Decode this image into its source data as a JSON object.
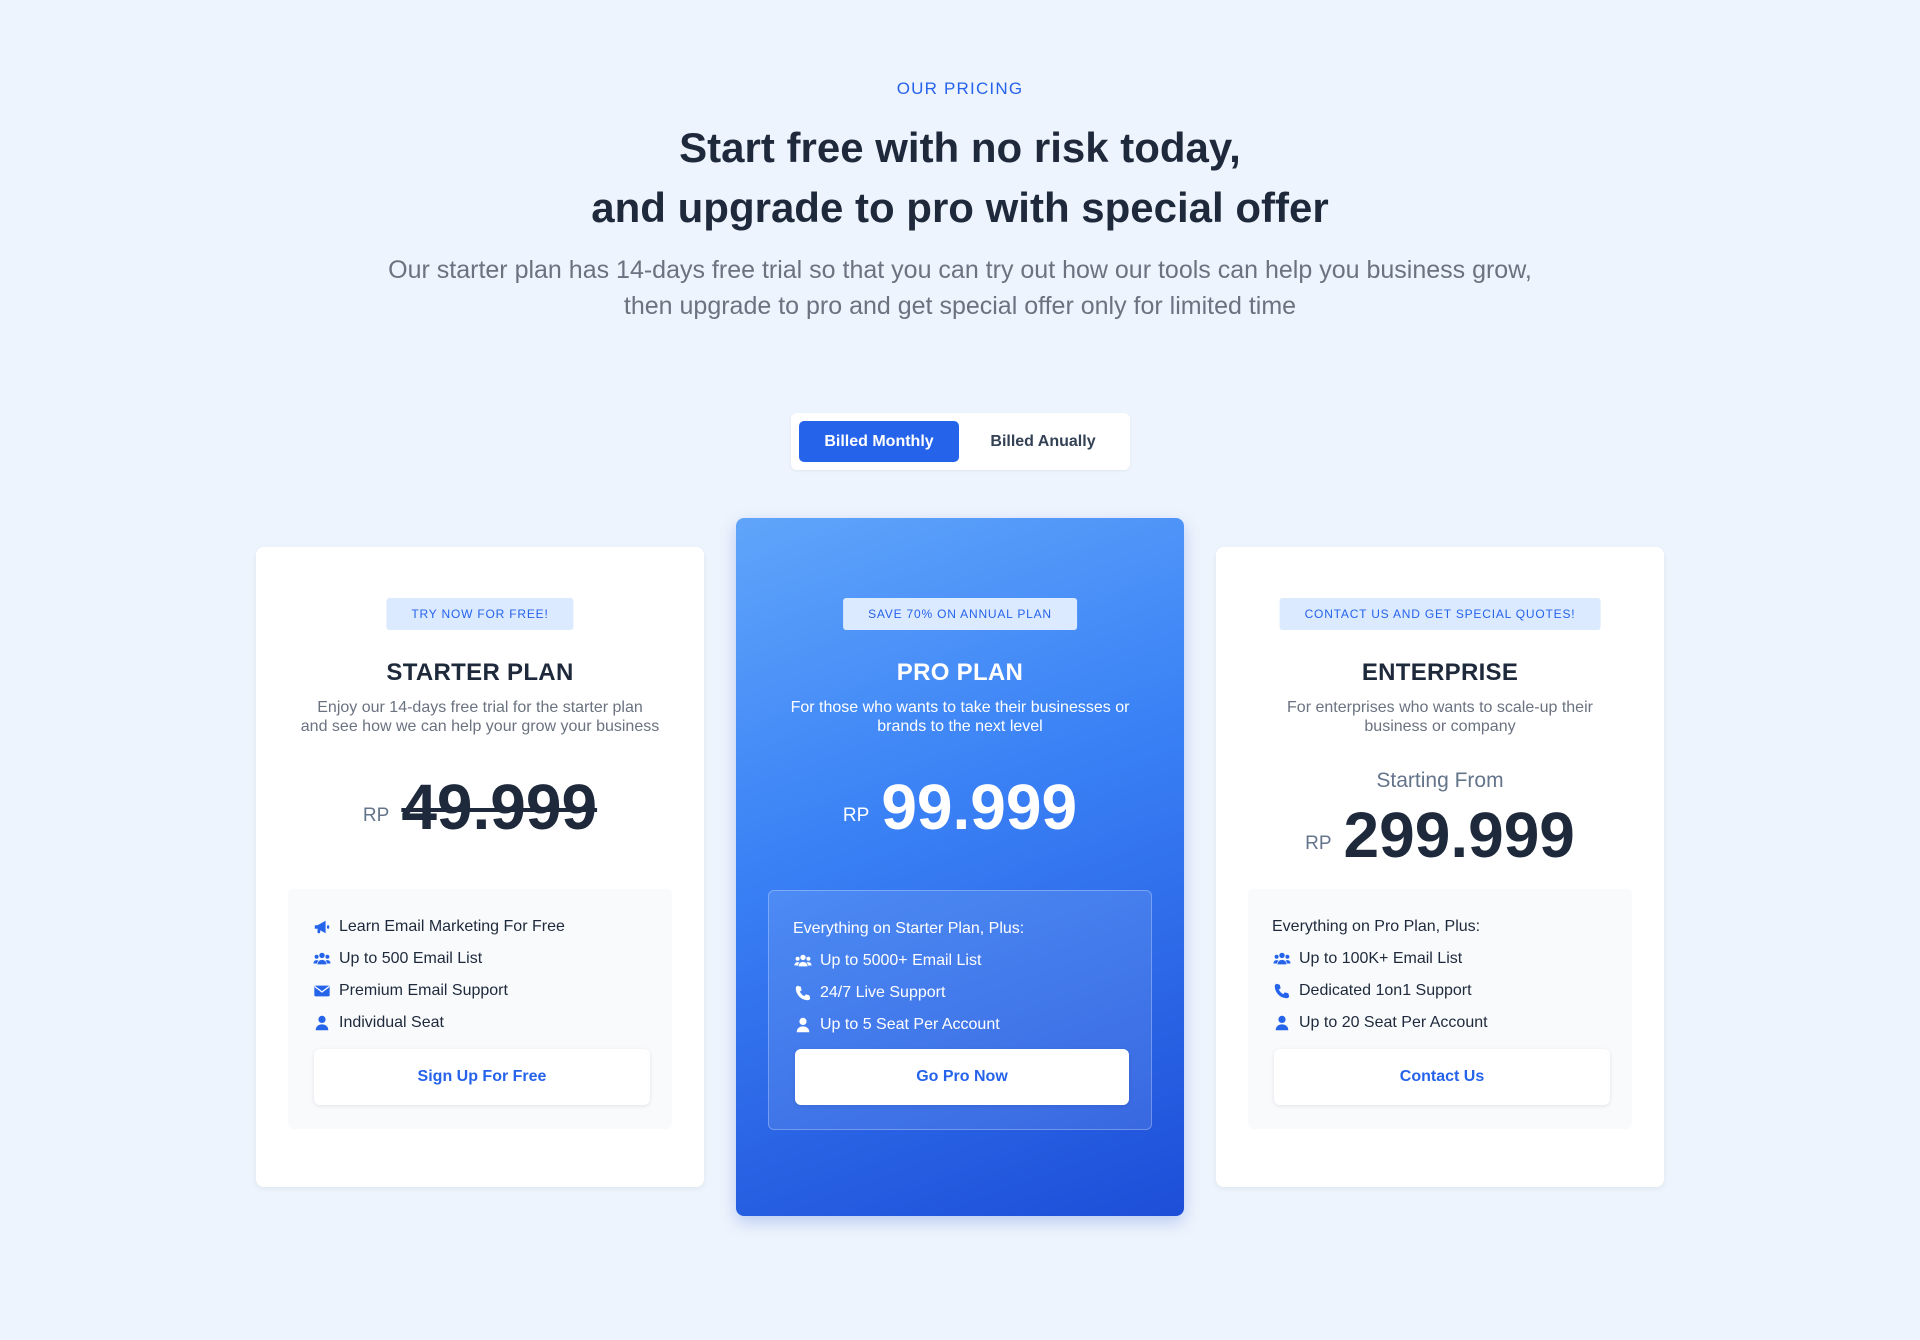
{
  "header": {
    "eyebrow": "OUR PRICING",
    "title_line1": "Start free with no risk today,",
    "title_line2": "and upgrade to pro with special offer",
    "subtitle_line1": "Our starter plan has 14-days free trial so that you can try out how our tools can help you business grow,",
    "subtitle_line2": "then upgrade to pro and get special offer only for limited time"
  },
  "billing": {
    "monthly_label": "Billed Monthly",
    "annual_label": "Billed Anually",
    "selected": "monthly"
  },
  "plans": {
    "starter": {
      "badge": "TRY NOW FOR FREE!",
      "name": "STARTER PLAN",
      "desc_line1": "Enjoy our 14-days free trial for the starter plan",
      "desc_line2": "and see how we can help your grow your business",
      "currency": "RP",
      "price": "49.999",
      "price_struck": true,
      "features": [
        {
          "icon": "megaphone-icon",
          "text": "Learn Email Marketing For Free"
        },
        {
          "icon": "users-icon",
          "text": "Up to 500 Email List"
        },
        {
          "icon": "envelope-icon",
          "text": "Premium Email Support"
        },
        {
          "icon": "user-icon",
          "text": "Individual Seat"
        }
      ],
      "cta": "Sign Up For Free"
    },
    "pro": {
      "badge": "SAVE 70% ON ANNUAL PLAN",
      "name": "PRO PLAN",
      "desc_line1": "For those who wants to take their businesses or",
      "desc_line2": "brands to the next level",
      "currency": "RP",
      "price": "99.999",
      "features_intro": "Everything on Starter Plan, Plus:",
      "features": [
        {
          "icon": "users-icon",
          "text": "Up to 5000+ Email List"
        },
        {
          "icon": "phone-icon",
          "text": "24/7 Live Support"
        },
        {
          "icon": "user-icon",
          "text": "Up to 5 Seat Per Account"
        }
      ],
      "cta": "Go Pro Now"
    },
    "enterprise": {
      "badge": "CONTACT US AND GET SPECIAL QUOTES!",
      "name": "ENTERPRISE",
      "desc_line1": "For enterprises who wants to scale-up their",
      "desc_line2": "business or company",
      "starting_from": "Starting From",
      "currency": "RP",
      "price": "299.999",
      "features_intro": "Everything on Pro Plan, Plus:",
      "features": [
        {
          "icon": "users-icon",
          "text": "Up to 100K+ Email List"
        },
        {
          "icon": "phone-icon",
          "text": "Dedicated 1on1 Support"
        },
        {
          "icon": "user-icon",
          "text": "Up to 20 Seat Per Account"
        }
      ],
      "cta": "Contact Us"
    }
  },
  "colors": {
    "background": "#eef4fd",
    "accent": "#2563eb",
    "badge_bg": "#dbeafe",
    "heading": "#1e293b",
    "muted": "#6b7280"
  }
}
